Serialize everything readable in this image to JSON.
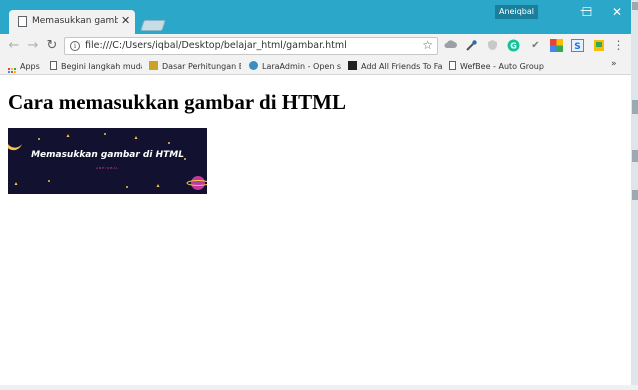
{
  "browser": {
    "tab_title": "Memasukkan gambar di",
    "tab_close": "✕",
    "user_badge": "Aneiqbal",
    "window_controls": {
      "minimize": "—",
      "maximize": "☐",
      "close": "✕"
    },
    "nav": {
      "back": "←",
      "forward": "→",
      "reload": "↻"
    },
    "url": "file:///C:/Users/iqbal/Desktop/belajar_html/gambar.html",
    "menu": "⋮"
  },
  "extensions": [
    "cloud-icon",
    "eyedropper-icon",
    "shield-icon",
    "grammarly-icon",
    "checkmark-icon",
    "chrome-colors-icon",
    "s-extension-icon",
    "bookmark-extension-icon"
  ],
  "bookmarks": {
    "apps_label": "Apps",
    "items": [
      {
        "label": "Begini langkah mudah",
        "icon": "page-icon"
      },
      {
        "label": "Dasar Perhitungan Be",
        "icon": "folder-person-icon"
      },
      {
        "label": "LaraAdmin - Open sou",
        "icon": "laraadmin-icon"
      },
      {
        "label": "Add All Friends To Fac",
        "icon": "dark-square-icon"
      },
      {
        "label": "WefBee - Auto Group",
        "icon": "page-icon"
      }
    ],
    "more": "»"
  },
  "page": {
    "heading": "Cara memasukkan gambar di HTML",
    "banner_title": "Memasukkan gambar di HTML",
    "banner_subtitle": "ANEIQBAL"
  },
  "colors": {
    "titlebar": "#2aa7c9",
    "toolbar": "#f2f2f2",
    "banner_bg": "#121230",
    "banner_star": "#f4c64f",
    "planet": "#c0399c"
  }
}
